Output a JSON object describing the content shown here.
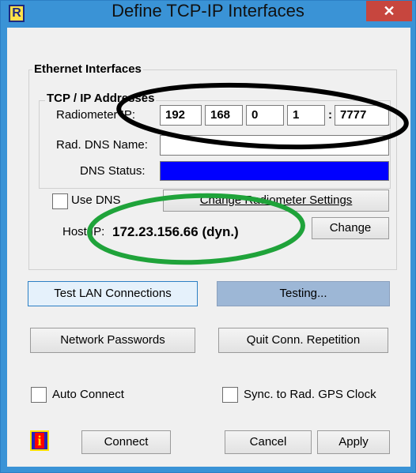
{
  "window": {
    "title": "Define TCP-IP Interfaces",
    "close_symbol": "✕"
  },
  "ethernet": {
    "group_label": "Ethernet Interfaces",
    "tcp": {
      "group_label": "TCP / IP Addresses",
      "radiometer_ip_label": "Radiometer  IP:",
      "ip_octets": [
        "192",
        "168",
        "0",
        "1"
      ],
      "port_separator": ":",
      "port": "7777",
      "dns_name_label": "Rad. DNS Name:",
      "dns_name_value": "",
      "dns_status_label": "DNS Status:",
      "dns_status_color": "#0000ff"
    },
    "use_dns_label": "Use DNS",
    "use_dns_checked": false,
    "change_radiometer_settings_label": "Change Radiometer Settings",
    "host_ip_label": "Host  IP:",
    "host_ip_value": "172.23.156.66 (dyn.)",
    "change_label": "Change"
  },
  "actions": {
    "test_lan_label": "Test LAN Connections",
    "testing_label": "Testing...",
    "network_passwords_label": "Network Passwords",
    "quit_conn_label": "Quit Conn. Repetition"
  },
  "options": {
    "auto_connect_label": "Auto Connect",
    "auto_connect_checked": false,
    "sync_gps_label": "Sync. to Rad. GPS Clock",
    "sync_gps_checked": false
  },
  "footer": {
    "info_icon": "info-icon",
    "connect_label": "Connect",
    "cancel_label": "Cancel",
    "apply_label": "Apply"
  },
  "annotations": {
    "black_ellipse_color": "#000000",
    "green_ellipse_color": "#1fa33a"
  }
}
